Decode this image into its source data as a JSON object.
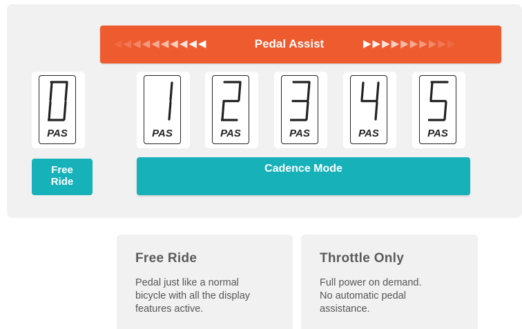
{
  "banner": {
    "label": "Pedal Assist",
    "left_arrows": [
      "◀",
      "◀",
      "◀",
      "◀",
      "◀",
      "◀",
      "◀",
      "◀",
      "◀",
      "◀"
    ],
    "right_arrows": [
      "▶",
      "▶",
      "▶",
      "▶",
      "▶",
      "▶",
      "▶",
      "▶",
      "▶",
      "▶"
    ],
    "color": "#ee5b2f"
  },
  "levels": [
    {
      "digit": "0",
      "unit": "PAS"
    },
    {
      "digit": "1",
      "unit": "PAS"
    },
    {
      "digit": "2",
      "unit": "PAS"
    },
    {
      "digit": "3",
      "unit": "PAS"
    },
    {
      "digit": "4",
      "unit": "PAS"
    },
    {
      "digit": "5",
      "unit": "PAS"
    }
  ],
  "modes": {
    "free_ride_line1": "Free",
    "free_ride_line2": "Ride",
    "cadence_label": "Cadence Mode",
    "color": "#17b1b9"
  },
  "info_cards": [
    {
      "title": "Free Ride",
      "lines": [
        "Pedal just like a normal",
        "bicycle with all the display",
        "features active."
      ]
    },
    {
      "title": "Throttle Only",
      "lines": [
        "Full power on demand.",
        "No automatic pedal",
        "assistance."
      ]
    }
  ]
}
